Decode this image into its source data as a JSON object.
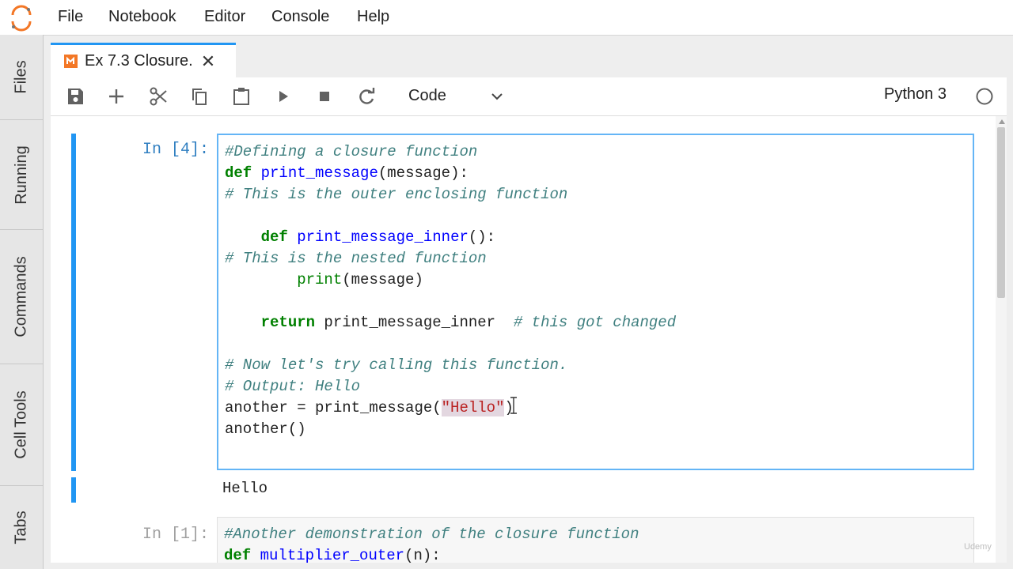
{
  "menu": [
    "File",
    "Notebook",
    "Editor",
    "Console",
    "Help"
  ],
  "sidebar": [
    "Files",
    "Running",
    "Commands",
    "Cell Tools",
    "Tabs"
  ],
  "tab": {
    "title": "Ex 7.3 Closure.",
    "close": "✕"
  },
  "toolbar": {
    "buttons": [
      "save-icon",
      "plus-icon",
      "scissors-icon",
      "copy-icon",
      "paste-icon",
      "play-icon",
      "stop-icon",
      "restart-icon"
    ],
    "cell_type": "Code",
    "kernel": "Python 3"
  },
  "cells": [
    {
      "prompt": "In [4]:",
      "lines": [
        "#Defining a closure function",
        "def print_message(message):",
        "# This is the outer enclosing function",
        "",
        "    def print_message_inner():",
        "# This is the nested function",
        "        print(message)",
        "",
        "    return print_message_inner  # this got changed",
        "",
        "# Now let's try calling this function.",
        "# Output: Hello",
        "another = print_message(\"Hello\")",
        "another()"
      ],
      "output": "Hello"
    },
    {
      "prompt": "In [1]:",
      "lines": [
        "#Another demonstration of the closure function",
        "def multiplier_outer(n):"
      ]
    }
  ],
  "colors": {
    "accent": "#2196f3",
    "prompt": "#307fc1",
    "keyword": "#008000",
    "function": "#0000ff",
    "comment": "#408080",
    "string": "#ba2121"
  },
  "watermark": "Udemy"
}
